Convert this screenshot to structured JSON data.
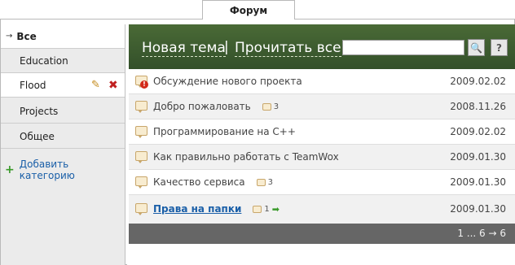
{
  "tab": {
    "label": "Форум"
  },
  "sidebar": {
    "items": [
      {
        "label": "Все"
      },
      {
        "label": "Education"
      },
      {
        "label": "Flood"
      },
      {
        "label": "Projects"
      },
      {
        "label": "Общее"
      }
    ],
    "add_label": "Добавить категорию"
  },
  "header": {
    "new_topic": "Новая тема",
    "separator": "|",
    "read_all": "Прочитать все",
    "search_value": "",
    "search_icon": "🔍",
    "help_label": "?"
  },
  "topics": [
    {
      "title": "Обсуждение нового проекта",
      "count": "",
      "date": "2009.02.02",
      "alert": true
    },
    {
      "title": "Добро пожаловать",
      "count": "3",
      "date": "2008.11.26"
    },
    {
      "title": "Программирование на C++",
      "count": "",
      "date": "2009.02.02"
    },
    {
      "title": "Как правильно работать с TeamWox",
      "count": "",
      "date": "2009.01.30"
    },
    {
      "title": "Качество сервиса",
      "count": "3",
      "date": "2009.01.30"
    },
    {
      "title": "Права на папки",
      "count": "1",
      "date": "2009.01.30",
      "unread": true
    }
  ],
  "pager": {
    "text": "1 ... 6 → 6"
  },
  "colors": {
    "header_bg": "#3d5a2e",
    "pager_bg": "#666666",
    "link": "#1a5fa8"
  }
}
